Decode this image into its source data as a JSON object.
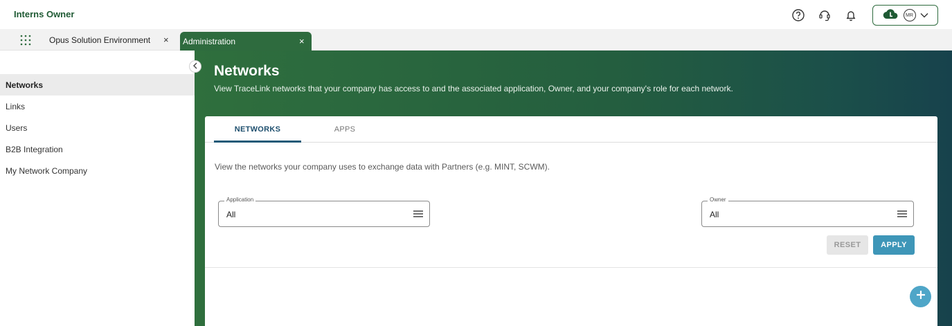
{
  "header": {
    "org_name": "Interns Owner",
    "icons": [
      "help-icon",
      "support-icon",
      "notification-bell-icon"
    ],
    "account": {
      "initials": "MR",
      "icons": [
        "cloud-icon",
        "chevron-down-icon"
      ]
    }
  },
  "tabs": [
    {
      "label": "Opus Solution Environment",
      "close": "×",
      "active": false
    },
    {
      "label": "Administration",
      "close": "×",
      "active": true
    }
  ],
  "sidebar": {
    "items": [
      {
        "label": "Networks",
        "active": true
      },
      {
        "label": "Links",
        "active": false
      },
      {
        "label": "Users",
        "active": false
      },
      {
        "label": "B2B Integration",
        "active": false
      },
      {
        "label": "My Network Company",
        "active": false
      }
    ]
  },
  "main": {
    "title": "Networks",
    "description": "View TraceLink networks that your company has access to and the associated application, Owner, and your company's role for each network.",
    "card": {
      "tabs": [
        {
          "label": "NETWORKS",
          "active": true
        },
        {
          "label": "APPS",
          "active": false
        }
      ],
      "description": "View the networks your company uses to exchange data with Partners (e.g. MINT, SCWM).",
      "filters": {
        "application": {
          "label": "Application",
          "value": "All"
        },
        "owner": {
          "label": "Owner",
          "value": "All"
        }
      },
      "buttons": {
        "reset": "RESET",
        "apply": "APPLY"
      }
    }
  },
  "colors": {
    "brand_green": "#2e6b3e",
    "header_gradient_end": "#17424c",
    "apply_button": "#3e96b8",
    "fab": "#4fa6c8",
    "tab_indicator": "#1f5a78"
  }
}
